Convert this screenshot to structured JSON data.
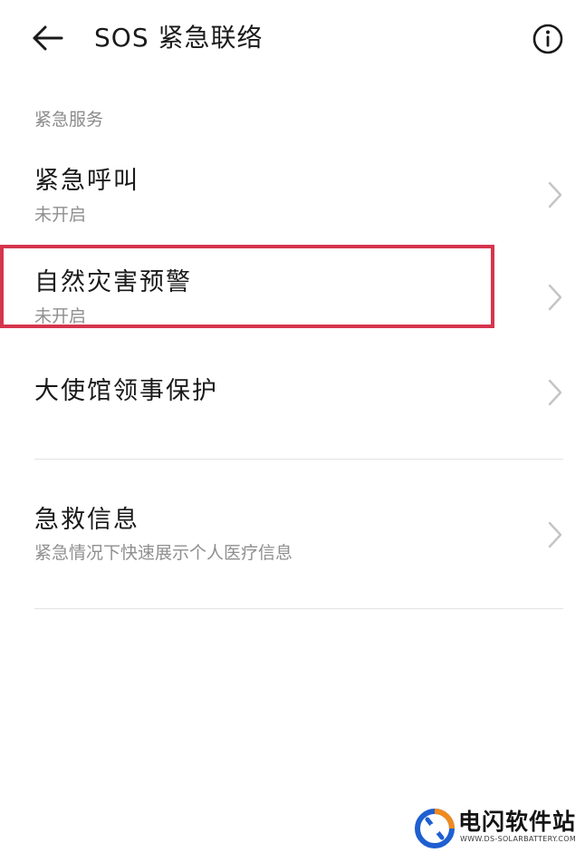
{
  "header": {
    "title": "SOS 紧急联络",
    "back_icon": "arrow-left-icon",
    "info_icon": "info-circle-icon"
  },
  "section": {
    "label": "紧急服务"
  },
  "items": [
    {
      "title": "紧急呼叫",
      "subtitle": "未开启"
    },
    {
      "title": "自然灾害预警",
      "subtitle": "未开启"
    },
    {
      "title": "大使馆领事保护",
      "subtitle": ""
    },
    {
      "title": "急救信息",
      "subtitle": "紧急情况下快速展示个人医疗信息"
    }
  ],
  "highlight": {
    "color": "#d6354e"
  },
  "watermark": {
    "brand": "电闪软件站",
    "url": "WWW.DS-SOLARBATTERY.COM"
  },
  "colors": {
    "text_primary": "#1a1a1a",
    "text_secondary": "#8f8f8f",
    "divider": "#e3e3e3",
    "chevron": "#c4c4c4"
  }
}
